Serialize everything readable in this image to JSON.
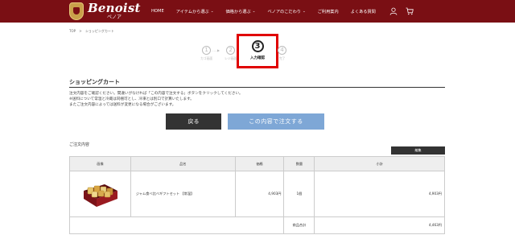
{
  "header": {
    "logo_main": "Benoist",
    "logo_sub": "ベノア",
    "nav": [
      {
        "label": "HOME",
        "has_dropdown": false
      },
      {
        "label": "アイテムから選ぶ",
        "has_dropdown": true
      },
      {
        "label": "価格から選ぶ",
        "has_dropdown": true
      },
      {
        "label": "ベノアのこだわり",
        "has_dropdown": true
      },
      {
        "label": "ご利用案内",
        "has_dropdown": false
      },
      {
        "label": "よくある質問",
        "has_dropdown": false
      }
    ],
    "icons": [
      "user-icon",
      "cart-icon"
    ],
    "bg_color": "#7a0f14"
  },
  "breadcrumb": [
    "TOP",
    ">",
    "ショッピングカート"
  ],
  "steps": {
    "items": [
      {
        "num": "1",
        "label": "カゴ画面"
      },
      {
        "num": "2",
        "label": "レジ画面"
      },
      {
        "num": "3",
        "label": "入力確認"
      },
      {
        "num": "4",
        "label": "完了"
      }
    ],
    "current_index": 2,
    "arrow": "……▶",
    "highlight_color": "#e00000"
  },
  "cart": {
    "title": "ショッピングカート",
    "notes": [
      "注文内容をご確認ください。間違いがなければ「この内容で注文する」ボタンをクリックしてください。",
      "※送料について常温と冷蔵は同梱可とし、冷凍とは別口で計算いたします。",
      "またご注文内容によっては送料が変更になる場合がございます。"
    ],
    "back_label": "戻る",
    "order_label": "この内容で注文する",
    "order_button_color": "#7ea7d6"
  },
  "order": {
    "title": "ご注文内容",
    "edit_label": "編集",
    "columns": [
      "画像",
      "品名",
      "価格",
      "数量",
      "小計"
    ],
    "items": [
      {
        "name": "ジャム食べ比べギフトセット 【常温】",
        "price": "4,903円",
        "qty": "1個",
        "subtotal": "4,903円",
        "image": "gift-box-image"
      }
    ],
    "subtotal_label": "商品合計",
    "subtotal_value": "4,463円"
  }
}
